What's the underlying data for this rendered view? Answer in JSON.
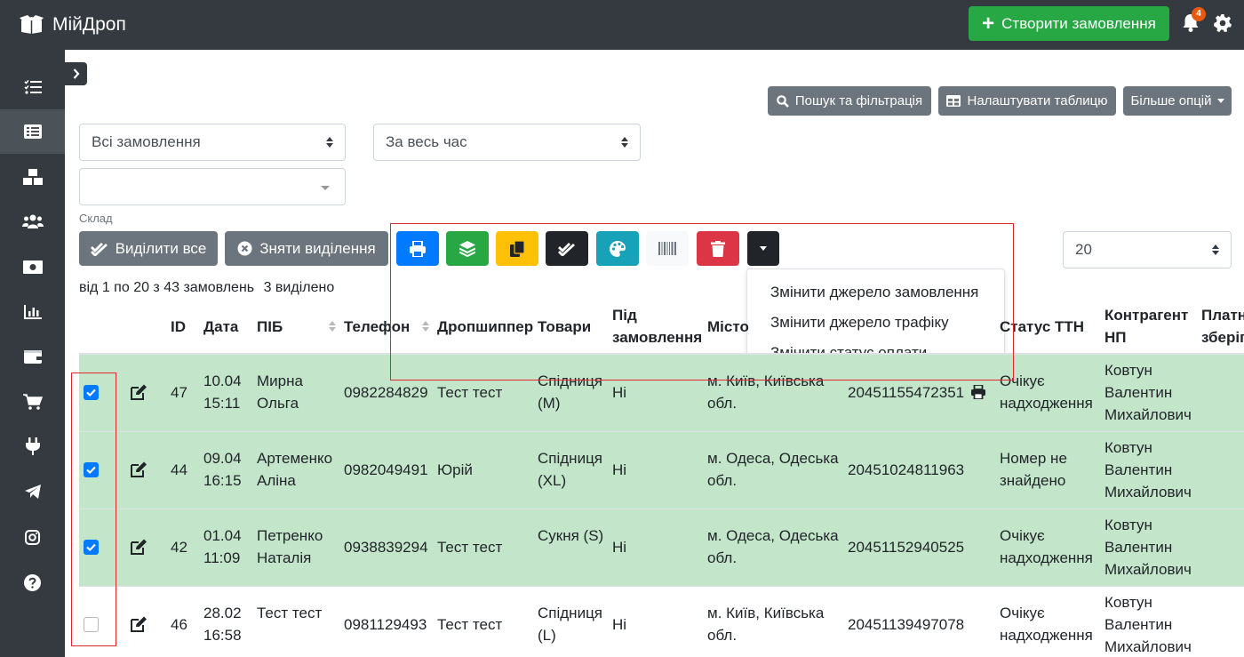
{
  "app": {
    "title": "МійДроп"
  },
  "header": {
    "create_label": "Створити замовлення",
    "notifications_count": "4"
  },
  "sidebar": {
    "items": [
      "tasks-icon",
      "orders-icon",
      "warehouse-icon",
      "users-icon",
      "money-icon",
      "chart-icon",
      "wallet-icon",
      "cart-icon",
      "plug-icon",
      "telegram-icon",
      "instagram-icon",
      "help-icon"
    ],
    "active": "orders-icon"
  },
  "toolbar": {
    "search_label": "Пошук та фільтрація",
    "table_settings_label": "Налаштувати таблицю",
    "more_label": "Більше опцій"
  },
  "filters": {
    "orders_value": "Всі замовлення",
    "period_value": "За весь час",
    "warehouse_value": "",
    "warehouse_label": "Склад"
  },
  "actions": {
    "select_all_label": "Виділити все",
    "deselect_label": "Зняти виділення"
  },
  "per_page": "20",
  "dropdown": {
    "items": [
      "Змінити джерело замовлення",
      "Змінити джерело трафіку",
      "Змінити статус оплати"
    ]
  },
  "summary": {
    "range": "від 1 по 20 з 43 замовлень",
    "selected": "3 виділено"
  },
  "table": {
    "headers": {
      "id": "ID",
      "date": "Дата",
      "name": "ПІБ",
      "phone": "Телефон",
      "dropshipper": "Дропшиппер",
      "goods": "Товари",
      "preorder_1": "Під",
      "preorder_2": "замовлення",
      "city": "Місто",
      "ttn_status": "Статус ТТН",
      "agent_1": "Контрагент",
      "agent_2": "НП",
      "pay_1": "Платн",
      "pay_2": "зберіг"
    },
    "rows": [
      {
        "checked": true,
        "id": "47",
        "date": "10.04",
        "time": "15:11",
        "name1": "Мирна",
        "name2": "Ольга",
        "phone": "0982284829",
        "dropshipper": "Тест тест",
        "goods1": "Спідниця",
        "goods2": "(M)",
        "preorder": "Ні",
        "city1": "м. Київ, Київська",
        "city2": "обл.",
        "ttn": "20451155472351",
        "status1": "Очікує",
        "status2": "надходження",
        "agent1": "Ковтун",
        "agent2": "Валентин",
        "agent3": "Михайлович"
      },
      {
        "checked": true,
        "id": "44",
        "date": "09.04",
        "time": "16:15",
        "name1": "Артеменко",
        "name2": "Аліна",
        "phone": "0982049491",
        "dropshipper": "Юрій",
        "goods1": "Спідниця",
        "goods2": "(XL)",
        "preorder": "Ні",
        "city1": "м. Одеса, Одеська",
        "city2": "обл.",
        "ttn": "20451024811963",
        "status1": "Номер не",
        "status2": "знайдено",
        "agent1": "Ковтун",
        "agent2": "Валентин",
        "agent3": "Михайлович"
      },
      {
        "checked": true,
        "id": "42",
        "date": "01.04",
        "time": "11:09",
        "name1": "Петренко",
        "name2": "Наталія",
        "phone": "0938839294",
        "dropshipper": "Тест тест",
        "goods1": "Сукня (S)",
        "goods2": "",
        "preorder": "Ні",
        "city1": "м. Одеса, Одеська",
        "city2": "обл.",
        "ttn": "20451152940525",
        "status1": "Очікує",
        "status2": "надходження",
        "agent1": "Ковтун",
        "agent2": "Валентин",
        "agent3": "Михайлович"
      },
      {
        "checked": false,
        "id": "46",
        "date": "28.02",
        "time": "16:58",
        "name1": "Тест тест",
        "name2": "",
        "phone": "0981129493",
        "dropshipper": "Тест тест",
        "goods1": "Спідниця",
        "goods2": "(L)",
        "preorder": "Ні",
        "city1": "м. Київ, Київська",
        "city2": "обл.",
        "ttn": "20451139497078",
        "status1": "Очікує",
        "status2": "надходження",
        "agent1": "Ковтун",
        "agent2": "Валентин",
        "agent3": "Михайлович"
      }
    ]
  },
  "colors": {
    "sidebar": "#343a40",
    "success": "#28a745",
    "primary": "#007bff",
    "warning": "#ffc107",
    "info": "#17a2b8",
    "danger": "#dc3545",
    "dark": "#212529",
    "selected_row": "#c3e6cb",
    "highlight": "#e0272f"
  }
}
